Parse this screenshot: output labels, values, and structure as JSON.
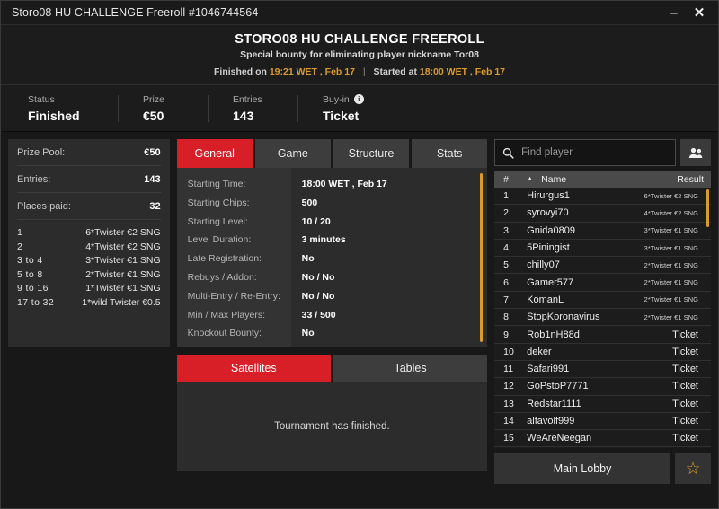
{
  "window": {
    "title": "Storo08 HU CHALLENGE Freeroll #1046744564",
    "minimize_label": "–",
    "close_label": "✕"
  },
  "header": {
    "title": "STORO08 HU CHALLENGE FREEROLL",
    "subtitle": "Special bounty for eliminating player nickname Tor08",
    "finished_label": "Finished on",
    "finished_value": "19:21 WET , Feb 17",
    "separator": "|",
    "started_label": "Started at",
    "started_value": "18:00 WET , Feb 17"
  },
  "status": {
    "items": [
      {
        "label": "Status",
        "value": "Finished",
        "info": false
      },
      {
        "label": "Prize",
        "value": "€50",
        "info": false
      },
      {
        "label": "Entries",
        "value": "143",
        "info": false
      },
      {
        "label": "Buy-in",
        "value": "Ticket",
        "info": true,
        "info_glyph": "i"
      }
    ]
  },
  "prize_panel": {
    "rows": [
      {
        "key": "Prize Pool:",
        "value": "€50"
      },
      {
        "key": "Entries:",
        "value": "143"
      },
      {
        "key": "Places paid:",
        "value": "32"
      }
    ],
    "payouts": [
      {
        "rank": "1",
        "prize": "6*Twister €2 SNG"
      },
      {
        "rank": "2",
        "prize": "4*Twister €2 SNG"
      },
      {
        "rank": "3  to  4",
        "prize": "3*Twister €1 SNG"
      },
      {
        "rank": "5  to  8",
        "prize": "2*Twister €1 SNG"
      },
      {
        "rank": "9  to  16",
        "prize": "1*Twister €1 SNG"
      },
      {
        "rank": "17  to  32",
        "prize": "1*wild Twister €0.5"
      }
    ]
  },
  "tabs": [
    {
      "label": "General",
      "active": true
    },
    {
      "label": "Game",
      "active": false
    },
    {
      "label": "Structure",
      "active": false
    },
    {
      "label": "Stats",
      "active": false
    }
  ],
  "general_info": {
    "rows": [
      {
        "label": "Starting Time:",
        "value": "18:00 WET , Feb 17"
      },
      {
        "label": "Starting Chips:",
        "value": "500"
      },
      {
        "label": "Starting Level:",
        "value": "10 / 20"
      },
      {
        "label": "Level Duration:",
        "value": "3 minutes"
      },
      {
        "label": "Late Registration:",
        "value": "No"
      },
      {
        "label": "Rebuys / Addon:",
        "value": "No / No"
      },
      {
        "label": "Multi-Entry / Re-Entry:",
        "value": "No / No"
      },
      {
        "label": "Min / Max Players:",
        "value": "33 / 500"
      },
      {
        "label": "Knockout Bounty:",
        "value": "No"
      }
    ]
  },
  "satellites": {
    "tabs": [
      {
        "label": "Satellites",
        "active": true
      },
      {
        "label": "Tables",
        "active": false
      }
    ],
    "message": "Tournament has finished."
  },
  "search": {
    "placeholder": "Find player",
    "value": "",
    "icon": "search-icon",
    "people_icon": "people-icon"
  },
  "player_list": {
    "columns": {
      "num": "#",
      "sort_arrow": "▲",
      "name": "Name",
      "result": "Result"
    },
    "rows": [
      {
        "num": "1",
        "name": "Hirurgus1",
        "result": "6*Twister €2 SNG",
        "small": true
      },
      {
        "num": "2",
        "name": "syrovyi70",
        "result": "4*Twister €2 SNG",
        "small": true
      },
      {
        "num": "3",
        "name": "Gnida0809",
        "result": "3*Twister €1 SNG",
        "small": true
      },
      {
        "num": "4",
        "name": "5Piningist",
        "result": "3*Twister €1 SNG",
        "small": true
      },
      {
        "num": "5",
        "name": "chilly07",
        "result": "2*Twister €1 SNG",
        "small": true
      },
      {
        "num": "6",
        "name": "Gamer577",
        "result": "2*Twister €1 SNG",
        "small": true
      },
      {
        "num": "7",
        "name": "KomanL",
        "result": "2*Twister €1 SNG",
        "small": true
      },
      {
        "num": "8",
        "name": "StopKoronavirus",
        "result": "2*Twister €1 SNG",
        "small": true
      },
      {
        "num": "9",
        "name": "Rob1nH88d",
        "result": "Ticket",
        "small": false
      },
      {
        "num": "10",
        "name": "deker",
        "result": "Ticket",
        "small": false
      },
      {
        "num": "11",
        "name": "Safari991",
        "result": "Ticket",
        "small": false
      },
      {
        "num": "12",
        "name": "GoPstoP7771",
        "result": "Ticket",
        "small": false
      },
      {
        "num": "13",
        "name": "Redstar1111",
        "result": "Ticket",
        "small": false
      },
      {
        "num": "14",
        "name": "alfavolf999",
        "result": "Ticket",
        "small": false
      },
      {
        "num": "15",
        "name": "WeAreNeegan",
        "result": "Ticket",
        "small": false
      }
    ]
  },
  "footer": {
    "lobby_label": "Main Lobby",
    "favorite_icon": "star-icon",
    "favorite_glyph": "☆"
  },
  "colors": {
    "accent_red": "#d81e26",
    "accent_orange": "#d99b2b",
    "panel": "#2c2c2c",
    "background": "#181818"
  }
}
